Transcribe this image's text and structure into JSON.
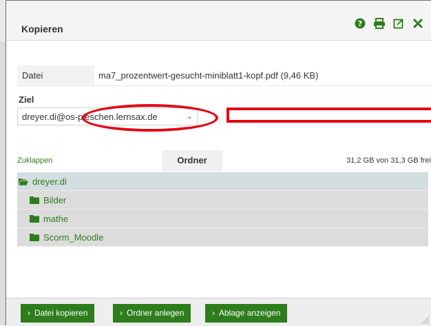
{
  "dialog": {
    "title": "Kopieren",
    "icons": [
      "help-icon",
      "print-icon",
      "external-link-icon",
      "close-icon"
    ]
  },
  "file": {
    "label": "Datei",
    "value": "ma7_prozentwert-gesucht-miniblatt1-kopf.pdf (9,46 KB)"
  },
  "target": {
    "label": "Ziel",
    "selected": "dreyer.di@os-pieschen.lernsax.de"
  },
  "tree": {
    "collapse_label": "Zuklappen",
    "tab_label": "Ordner",
    "space_info": "31,2 GB von 31,3 GB frei",
    "root": "dreyer.di",
    "folders": [
      "Bilder",
      "mathe",
      "Scorm_Moodle"
    ]
  },
  "footer": {
    "buttons": [
      "Datei kopieren",
      "Ordner anlegen",
      "Ablage anzeigen"
    ]
  },
  "colors": {
    "accent": "#2e7d1c",
    "annotation": "#e30613"
  }
}
